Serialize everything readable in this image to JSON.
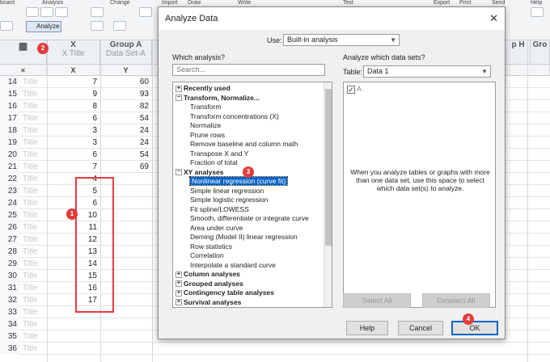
{
  "ribbon": {
    "groups": [
      "board",
      "Analysis",
      "Change",
      "Import",
      "Draw",
      "Write",
      "Text",
      "Export",
      "Print",
      "Send",
      "Help"
    ],
    "analyze_label": "Analyze"
  },
  "sheet": {
    "col_x": {
      "name": "X",
      "title": "X Title",
      "sub": "X"
    },
    "col_a": {
      "name": "Group A",
      "title": "Data Set-A",
      "sub": "Y"
    },
    "col_h": "p H",
    "col_g": "Gro",
    "rows": [
      {
        "n": "14",
        "t": "Title",
        "x": "7",
        "y": "60"
      },
      {
        "n": "15",
        "t": "Title",
        "x": "9",
        "y": "93"
      },
      {
        "n": "16",
        "t": "Title",
        "x": "8",
        "y": "82"
      },
      {
        "n": "17",
        "t": "Title",
        "x": "6",
        "y": "54"
      },
      {
        "n": "18",
        "t": "Title",
        "x": "3",
        "y": "24"
      },
      {
        "n": "19",
        "t": "Title",
        "x": "3",
        "y": "24"
      },
      {
        "n": "20",
        "t": "Title",
        "x": "6",
        "y": "54"
      },
      {
        "n": "21",
        "t": "Title",
        "x": "7",
        "y": "69"
      },
      {
        "n": "22",
        "t": "Title",
        "x": "4",
        "y": ""
      },
      {
        "n": "23",
        "t": "Title",
        "x": "5",
        "y": ""
      },
      {
        "n": "24",
        "t": "Title",
        "x": "6",
        "y": ""
      },
      {
        "n": "25",
        "t": "Title",
        "x": "10",
        "y": ""
      },
      {
        "n": "26",
        "t": "Title",
        "x": "11",
        "y": ""
      },
      {
        "n": "27",
        "t": "Title",
        "x": "12",
        "y": ""
      },
      {
        "n": "28",
        "t": "Title",
        "x": "13",
        "y": ""
      },
      {
        "n": "29",
        "t": "Title",
        "x": "14",
        "y": ""
      },
      {
        "n": "30",
        "t": "Title",
        "x": "15",
        "y": ""
      },
      {
        "n": "31",
        "t": "Title",
        "x": "16",
        "y": ""
      },
      {
        "n": "32",
        "t": "Title",
        "x": "17",
        "y": ""
      },
      {
        "n": "33",
        "t": "Title",
        "x": "",
        "y": ""
      },
      {
        "n": "34",
        "t": "Title",
        "x": "",
        "y": ""
      },
      {
        "n": "35",
        "t": "Title",
        "x": "",
        "y": ""
      },
      {
        "n": "36",
        "t": "Title",
        "x": "",
        "y": ""
      }
    ]
  },
  "annotations": {
    "b1": "1",
    "b2": "2",
    "b3": "3",
    "b4": "4"
  },
  "dialog": {
    "title": "Analyze Data",
    "use_label": "Use:",
    "use_value": "Built-in analysis",
    "which_analysis": "Which analysis?",
    "search_placeholder": "Search...",
    "which_datasets": "Analyze which data sets?",
    "table_label": "Table:",
    "table_value": "Data 1",
    "dataset": "A",
    "note": "When you analyze tables or graphs with more than one data set, use this space to select which data set(s) to analyze.",
    "select_all": "Select All",
    "deselect_all": "Deselect All",
    "help": "Help",
    "cancel": "Cancel",
    "ok": "OK",
    "tree": [
      {
        "label": "Recently used",
        "type": "cat",
        "toggle": "+"
      },
      {
        "label": "Transform, Normalize...",
        "type": "cat",
        "toggle": "−"
      },
      {
        "label": "Transform",
        "type": "sub"
      },
      {
        "label": "Transform concentrations (X)",
        "type": "sub"
      },
      {
        "label": "Normalize",
        "type": "sub"
      },
      {
        "label": "Prune rows",
        "type": "sub"
      },
      {
        "label": "Remove baseline and column math",
        "type": "sub"
      },
      {
        "label": "Transpose X and Y",
        "type": "sub"
      },
      {
        "label": "Fraction of total",
        "type": "sub"
      },
      {
        "label": "XY analyses",
        "type": "cat",
        "toggle": "−"
      },
      {
        "label": "Nonlinear regression (curve fit)",
        "type": "sub",
        "selected": true
      },
      {
        "label": "Simple linear regression",
        "type": "sub"
      },
      {
        "label": "Simple logistic regression",
        "type": "sub"
      },
      {
        "label": "Fit spline/LOWESS",
        "type": "sub"
      },
      {
        "label": "Smooth, differentiate or integrate curve",
        "type": "sub"
      },
      {
        "label": "Area under curve",
        "type": "sub"
      },
      {
        "label": "Deming (Model II) linear regression",
        "type": "sub"
      },
      {
        "label": "Row statistics",
        "type": "sub"
      },
      {
        "label": "Correlation",
        "type": "sub"
      },
      {
        "label": "Interpolate a standard curve",
        "type": "sub"
      },
      {
        "label": "Column analyses",
        "type": "cat",
        "toggle": "+"
      },
      {
        "label": "Grouped analyses",
        "type": "cat",
        "toggle": "+"
      },
      {
        "label": "Contingency table analyses",
        "type": "cat",
        "toggle": "+"
      },
      {
        "label": "Survival analyses",
        "type": "cat",
        "toggle": "+"
      }
    ]
  }
}
